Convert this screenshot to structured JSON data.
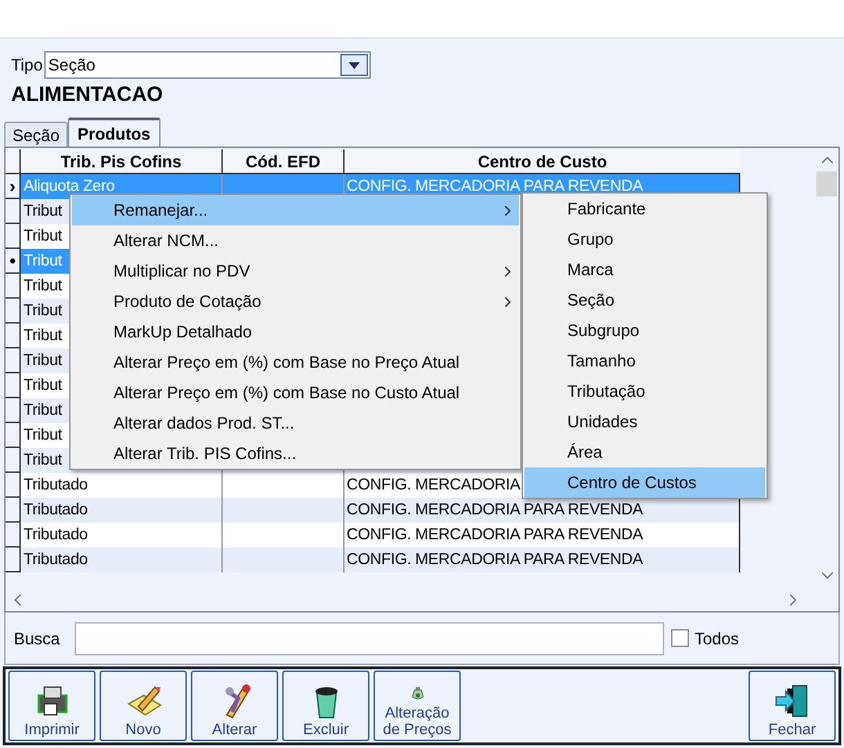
{
  "tipo": {
    "label": "Tipo",
    "value": "Seção"
  },
  "heading": "ALIMENTACAO",
  "tabs": [
    {
      "label": "Seção",
      "selected": false
    },
    {
      "label": "Produtos",
      "selected": true
    }
  ],
  "table": {
    "columns": [
      "Trib. Pis Cofins",
      "Cód. EFD",
      "Centro de Custo"
    ],
    "rows": [
      {
        "cells": [
          "Aliquota Zero",
          "",
          "CONFIG. MERCADORIA PARA REVENDA"
        ],
        "selected": true,
        "indicator": "›"
      },
      {
        "cells": [
          "Tribut",
          "",
          ""
        ],
        "selected": false
      },
      {
        "cells": [
          "Tribut",
          "",
          ""
        ],
        "selected": false
      },
      {
        "cells": [
          "Tribut",
          "",
          ""
        ],
        "selected": true,
        "indicator": "•"
      },
      {
        "cells": [
          "Tribut",
          "",
          ""
        ],
        "selected": false
      },
      {
        "cells": [
          "Tribut",
          "",
          ""
        ],
        "selected": false
      },
      {
        "cells": [
          "Tribut",
          "",
          ""
        ],
        "selected": false
      },
      {
        "cells": [
          "Tribut",
          "",
          ""
        ],
        "selected": false
      },
      {
        "cells": [
          "Tribut",
          "",
          ""
        ],
        "selected": false
      },
      {
        "cells": [
          "Tribut",
          "",
          ""
        ],
        "selected": false
      },
      {
        "cells": [
          "Tribut",
          "",
          ""
        ],
        "selected": false
      },
      {
        "cells": [
          "Tribut",
          "",
          ""
        ],
        "selected": false
      },
      {
        "cells": [
          "Tributado",
          "",
          "CONFIG. MERCADORIA"
        ],
        "selected": false
      },
      {
        "cells": [
          "Tributado",
          "",
          "CONFIG. MERCADORIA PARA REVENDA"
        ],
        "selected": false
      },
      {
        "cells": [
          "Tributado",
          "",
          "CONFIG. MERCADORIA PARA REVENDA"
        ],
        "selected": false
      },
      {
        "cells": [
          "Tributado",
          "",
          "CONFIG. MERCADORIA PARA REVENDA"
        ],
        "selected": false
      }
    ]
  },
  "context_menu": {
    "items": [
      {
        "label": "Remanejar...",
        "submenu": true,
        "selected": true
      },
      {
        "label": "Alterar NCM...",
        "submenu": false,
        "selected": false
      },
      {
        "label": "Multiplicar no PDV",
        "submenu": true,
        "selected": false
      },
      {
        "label": "Produto de Cotação",
        "submenu": true,
        "selected": false
      },
      {
        "label": "MarkUp Detalhado",
        "submenu": false,
        "selected": false
      },
      {
        "label": "Alterar Preço em (%) com Base no Preço Atual",
        "submenu": false,
        "selected": false
      },
      {
        "label": "Alterar Preço em (%) com Base no Custo Atual",
        "submenu": false,
        "selected": false
      },
      {
        "label": "Alterar dados Prod. ST...",
        "submenu": false,
        "selected": false
      },
      {
        "label": "Alterar Trib. PIS Cofins...",
        "submenu": false,
        "selected": false
      }
    ],
    "submenu": [
      {
        "label": "Fabricante",
        "selected": false
      },
      {
        "label": "Grupo",
        "selected": false
      },
      {
        "label": "Marca",
        "selected": false
      },
      {
        "label": "Seção",
        "selected": false
      },
      {
        "label": "Subgrupo",
        "selected": false
      },
      {
        "label": "Tamanho",
        "selected": false
      },
      {
        "label": "Tributação",
        "selected": false
      },
      {
        "label": "Unidades",
        "selected": false
      },
      {
        "label": "Área",
        "selected": false
      },
      {
        "label": "Centro de Custos",
        "selected": true
      }
    ]
  },
  "search": {
    "label": "Busca",
    "checkbox": {
      "label": "Todos",
      "checked": false
    }
  },
  "toolbar": [
    {
      "label": "Imprimir",
      "kind": "printer"
    },
    {
      "label": "Novo",
      "kind": "new"
    },
    {
      "label": "Alterar",
      "kind": "edit"
    },
    {
      "label": "Excluir",
      "kind": "delete"
    },
    {
      "label": "Alteração de Preços",
      "kind": "prices"
    },
    {
      "label": "Fechar",
      "kind": "exit"
    }
  ]
}
